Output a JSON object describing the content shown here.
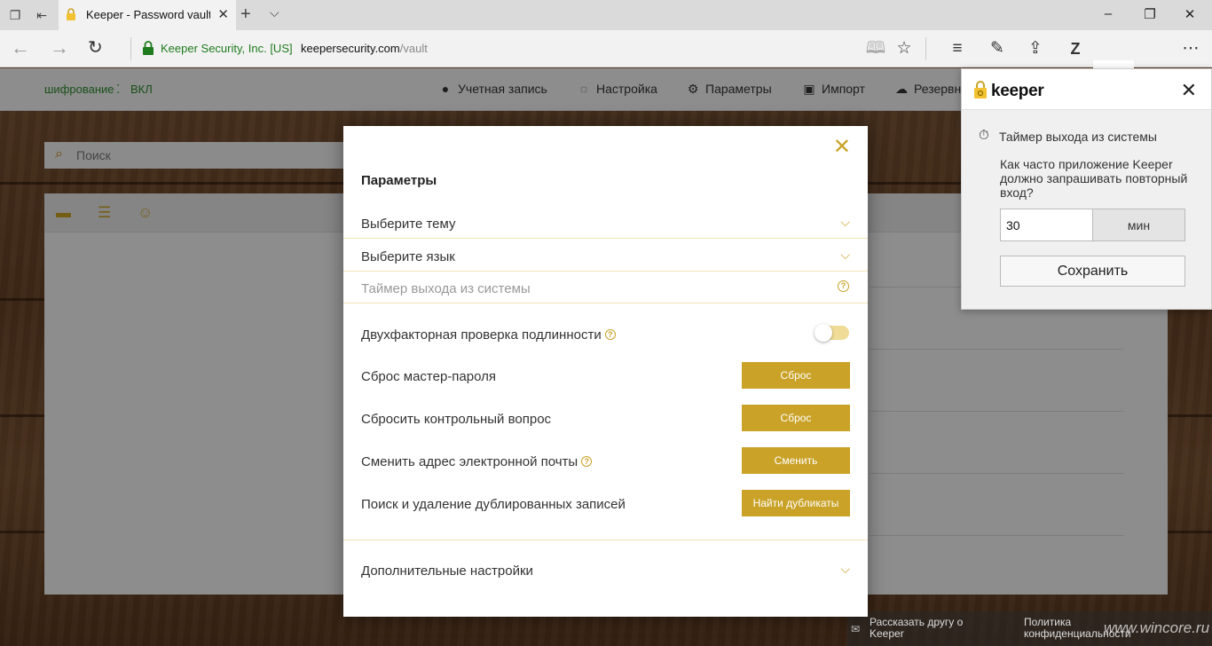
{
  "browser": {
    "tab_title": "Keeper - Password vault",
    "cert_label": "Keeper Security, Inc. [US]",
    "url_host": "keepersecurity.com",
    "url_path": "/vault",
    "z_label": "Z"
  },
  "app": {
    "encryption_label": "шифрование",
    "encryption_value": "ВКЛ",
    "menu": {
      "account": "Учетная запись",
      "setup": "Настройка",
      "settings": "Параметры",
      "import": "Импорт",
      "backup": "Резервн"
    },
    "search_placeholder": "Поиск",
    "footer": {
      "tell_friend": "Рассказать другу о Keeper",
      "privacy": "Политика конфиденциальности"
    },
    "watermark": "www.wincore.ru"
  },
  "modal": {
    "title": "Параметры",
    "rows": {
      "theme": "Выберите тему",
      "language": "Выберите язык",
      "logout_timer": "Таймер выхода из системы"
    },
    "settings": {
      "two_factor": "Двухфакторная проверка подлинности",
      "reset_master": "Сброс мастер-пароля",
      "reset_master_btn": "Сброс",
      "reset_question": "Сбросить контрольный вопрос",
      "reset_question_btn": "Сброс",
      "change_email": "Сменить адрес электронной почты",
      "change_email_btn": "Сменить",
      "duplicates": "Поиск и удаление дублированных записей",
      "duplicates_btn": "Найти дубликаты"
    },
    "advanced": "Дополнительные настройки",
    "two_factor_enabled": false
  },
  "popup": {
    "brand": "keeper",
    "timer_title": "Таймер выхода из системы",
    "question": "Как часто приложение Keeper должно запрашивать повторный вход?",
    "value": "30",
    "unit": "мин",
    "save": "Сохранить"
  },
  "colors": {
    "accent_gold": "#c9a227",
    "secure_green": "#1e7b1e",
    "edge_blue": "#2b6fd6"
  }
}
